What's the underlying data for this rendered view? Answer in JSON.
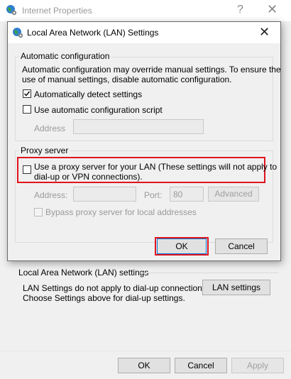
{
  "outer_window": {
    "title": "Internet Properties",
    "help_glyph": "?",
    "close_glyph": "✕",
    "icon": "internet-options-icon",
    "lan_section": {
      "heading": "Local Area Network (LAN) settings",
      "description_line1": "LAN Settings do not apply to dial-up connections.",
      "description_line2": "Choose Settings above for dial-up settings.",
      "button_label": "LAN settings"
    },
    "footer": {
      "ok_label": "OK",
      "cancel_label": "Cancel",
      "apply_label": "Apply"
    }
  },
  "dialog": {
    "title": "Local Area Network (LAN) Settings",
    "close_glyph": "✕",
    "icon": "internet-options-icon",
    "automatic_configuration": {
      "legend": "Automatic configuration",
      "description_line1": "Automatic configuration may override manual settings.  To ensure the",
      "description_line2": "use of manual settings, disable automatic configuration.",
      "auto_detect_label": "Automatically detect settings",
      "auto_detect_checked": true,
      "script_label": "Use automatic configuration script",
      "script_checked": false,
      "address_label": "Address",
      "address_value": ""
    },
    "proxy_server": {
      "legend": "Proxy server",
      "use_proxy_line1": "Use a proxy server for your LAN (These settings will not apply to",
      "use_proxy_line2": "dial-up or VPN connections).",
      "use_proxy_checked": false,
      "address_label": "Address:",
      "address_value": "",
      "port_label": "Port:",
      "port_value": "80",
      "advanced_label": "Advanced",
      "bypass_label": "Bypass proxy server for local addresses",
      "bypass_checked": false
    },
    "ok_label": "OK",
    "cancel_label": "Cancel"
  },
  "colors": {
    "highlight_box": "#e0141e",
    "default_button_border": "#0078d7",
    "window_bg": "#f0f0f0"
  }
}
